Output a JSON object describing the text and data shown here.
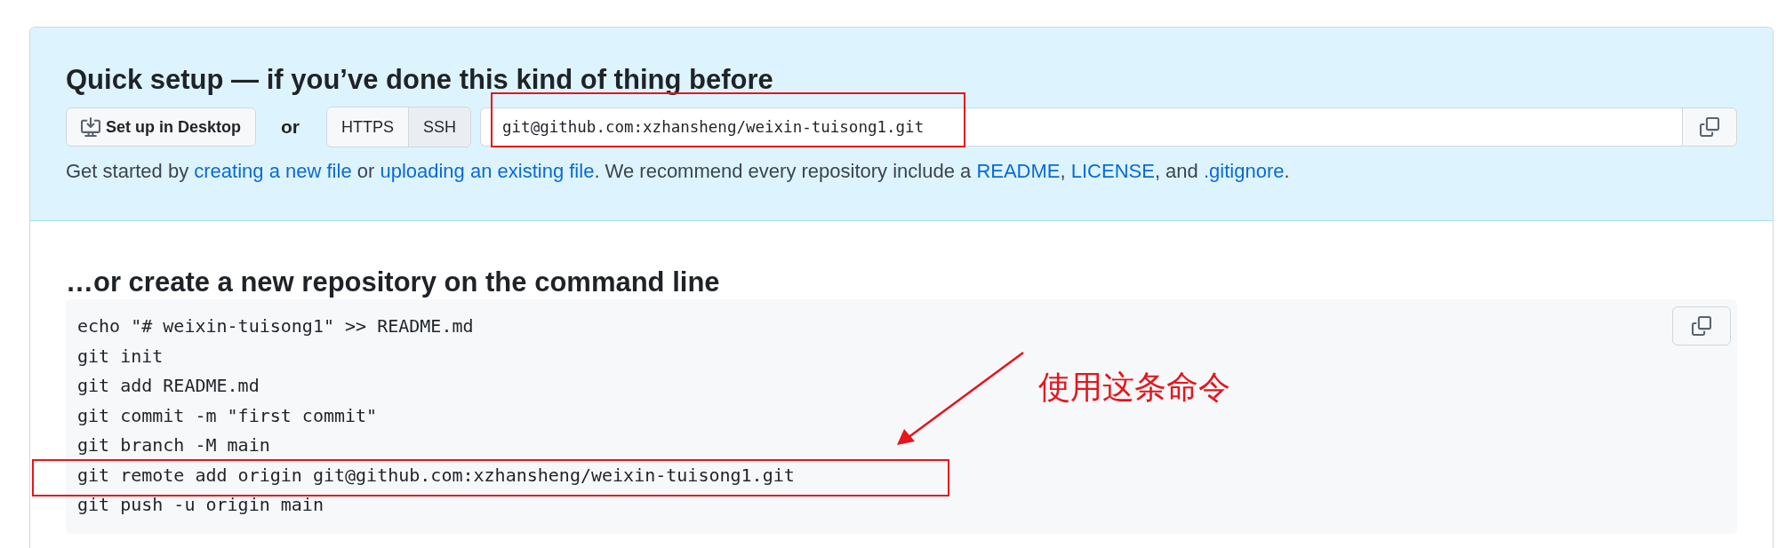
{
  "quick_setup": {
    "title": "Quick setup — if you’ve done this kind of thing before",
    "desktop_button": "Set up in Desktop",
    "or": "or",
    "protocols": [
      {
        "label": "HTTPS",
        "selected": false
      },
      {
        "label": "SSH",
        "selected": true
      }
    ],
    "clone_url": "git@github.com:xzhansheng/weixin-tuisong1.git",
    "help_parts": [
      {
        "text": "Get started by ",
        "link": false
      },
      {
        "text": "creating a new file",
        "link": true
      },
      {
        "text": " or ",
        "link": false
      },
      {
        "text": "uploading an existing file",
        "link": true
      },
      {
        "text": ". We recommend every repository include a ",
        "link": false
      },
      {
        "text": "README",
        "link": true
      },
      {
        "text": ", ",
        "link": false
      },
      {
        "text": "LICENSE",
        "link": true
      },
      {
        "text": ", and ",
        "link": false
      },
      {
        "text": ".gitignore",
        "link": true
      },
      {
        "text": ".",
        "link": false
      }
    ]
  },
  "command_line": {
    "title": "…or create a new repository on the command line",
    "lines": [
      {
        "text": "echo \"# weixin-tuisong1\" >> README.md",
        "highlighted": false
      },
      {
        "text": "git init",
        "highlighted": false
      },
      {
        "text": "git add README.md",
        "highlighted": false
      },
      {
        "text": "git commit -m \"first commit\"",
        "highlighted": false
      },
      {
        "text": "git branch -M main",
        "highlighted": false
      },
      {
        "text": "git remote add origin git@github.com:xzhansheng/weixin-tuisong1.git",
        "highlighted": true
      },
      {
        "text": "git push -u origin main",
        "highlighted": false
      }
    ]
  },
  "annotation": {
    "label": "使用这条命令"
  }
}
